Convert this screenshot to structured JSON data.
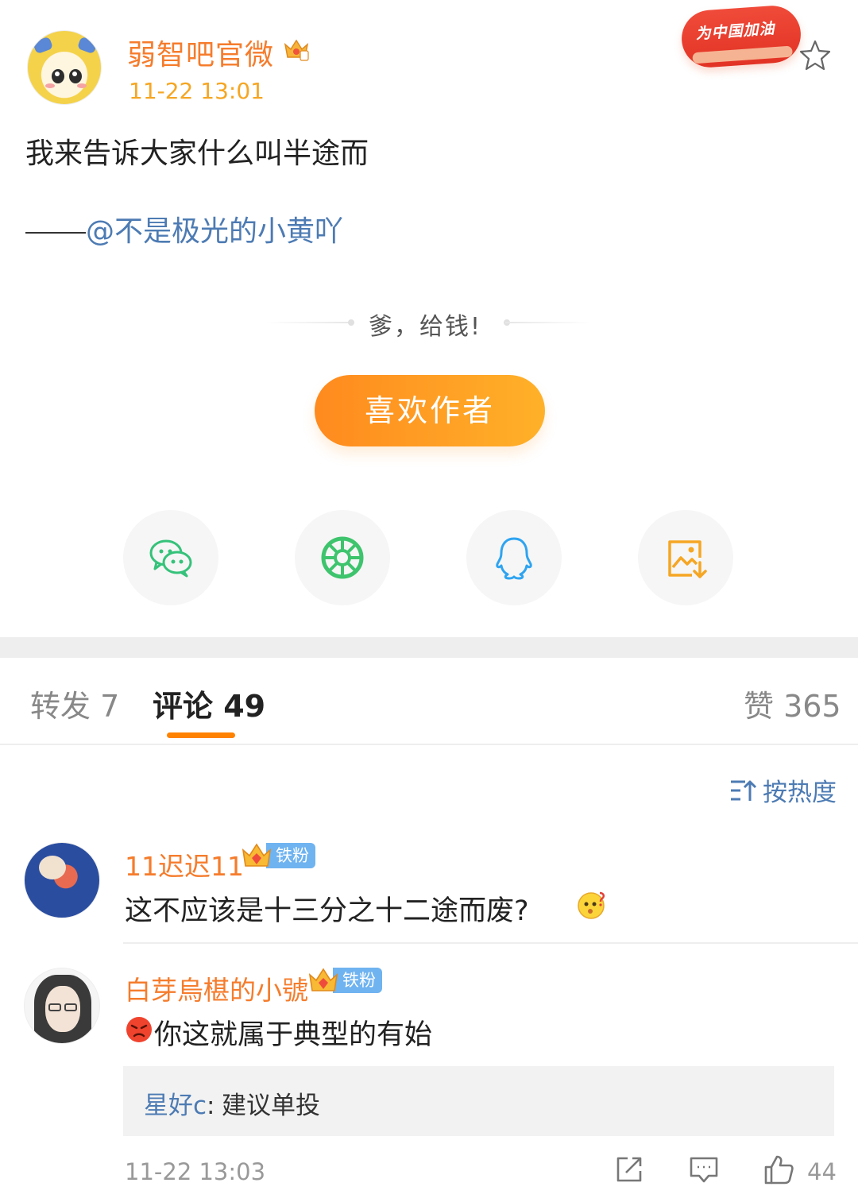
{
  "post": {
    "author": "弱智吧官微",
    "time": "11-22 13:01",
    "badge_label": "为中国加油",
    "text": "我来告诉大家什么叫半途而",
    "credit_mention": "@不是极光的小黄吖",
    "reward_prompt": "爹，给钱!",
    "like_author_button": "喜欢作者"
  },
  "share_icons": [
    "wechat-icon",
    "moments-icon",
    "qq-icon",
    "save-image-icon"
  ],
  "tabs": {
    "repost": "转发 7",
    "comments": "评论 49",
    "likes": "赞 365"
  },
  "sort": {
    "label": "按热度"
  },
  "comments": [
    {
      "author": "11迟迟11",
      "badge": "铁粉",
      "text": "这不应该是十三分之十二途而废?"
    },
    {
      "author": "白芽烏椹的小號",
      "badge": "铁粉",
      "text": "你这就属于典型的有始",
      "reply": {
        "author": "星好c",
        "separator": ":",
        "text": "建议单投"
      },
      "time": "11-22 13:03",
      "likes": "44"
    }
  ],
  "colors": {
    "accent_orange": "#ff8200",
    "name_orange": "#f57c2c",
    "link_blue": "#4d7bb3",
    "badge_blue": "#6fb3f0"
  }
}
